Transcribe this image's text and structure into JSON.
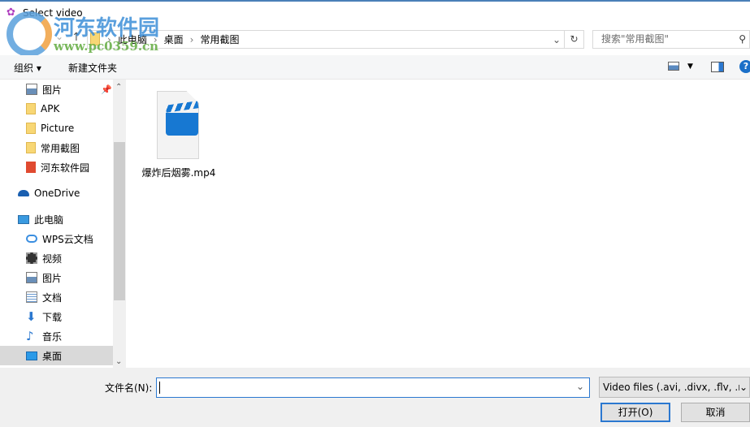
{
  "window": {
    "title": "Select video"
  },
  "watermark": {
    "name": "河东软件园",
    "url": "www.pc0359.cn"
  },
  "address": {
    "crumbs": [
      "此电脑",
      "桌面",
      "常用截图"
    ]
  },
  "search": {
    "placeholder": "搜索\"常用截图\""
  },
  "toolbar": {
    "organize": "组织 ▾",
    "new_folder": "新建文件夹"
  },
  "sidebar": {
    "items": [
      {
        "label": "图片",
        "icon": "pictures-icon"
      },
      {
        "label": "APK",
        "icon": "folder-icon"
      },
      {
        "label": "Picture",
        "icon": "folder-icon"
      },
      {
        "label": "常用截图",
        "icon": "folder-icon"
      },
      {
        "label": "河东软件园",
        "icon": "folder-red-icon"
      },
      {
        "label": "OneDrive",
        "icon": "onedrive-icon"
      },
      {
        "label": "此电脑",
        "icon": "computer-icon"
      },
      {
        "label": "WPS云文档",
        "icon": "cloud-icon"
      },
      {
        "label": "视频",
        "icon": "video-icon"
      },
      {
        "label": "图片",
        "icon": "pictures-icon"
      },
      {
        "label": "文档",
        "icon": "document-icon"
      },
      {
        "label": "下载",
        "icon": "download-icon"
      },
      {
        "label": "音乐",
        "icon": "music-icon"
      },
      {
        "label": "桌面",
        "icon": "desktop-icon"
      }
    ]
  },
  "files": [
    {
      "name": "爆炸后烟雾.mp4"
    }
  ],
  "bottom": {
    "filename_label": "文件名(N):",
    "filename_value": "",
    "filter": "Video files (.avi, .divx, .flv, .m",
    "open": "打开(O)",
    "cancel": "取消"
  }
}
